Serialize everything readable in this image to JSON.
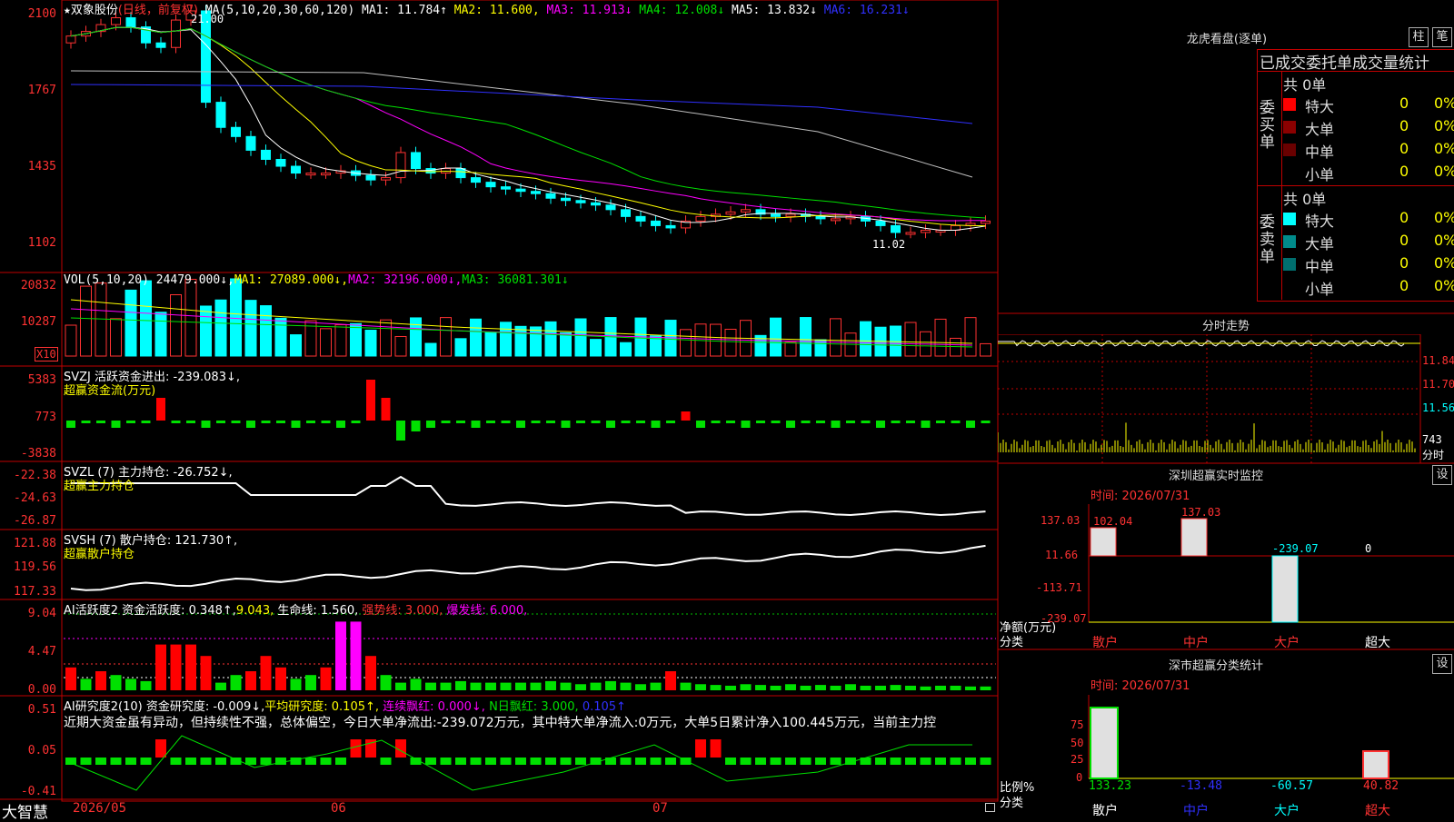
{
  "main_chart": {
    "star": "★",
    "stock_name": "双象股份",
    "mode": "(日线，前复权)",
    "ma_label": "MA(5,10,20,30,60,120)",
    "ma1": "MA1: 11.784↑",
    "ma2": "MA2: 11.600,",
    "ma3": "MA3: 11.913↓",
    "ma4": "MA4: 12.008↓",
    "ma5": "MA5: 13.832↓",
    "ma6": "MA6: 16.231↓",
    "high_label": "21.00",
    "low_label": "11.02",
    "y_ticks": [
      "2100",
      "1767",
      "1435",
      "1102"
    ],
    "colors": {
      "up": "#ff3232",
      "down": "#00ffff",
      "ma1": "#ffffff",
      "ma2": "#ffff00",
      "ma3": "#ff00ff",
      "ma4": "#00e000",
      "ma5": "#c0c0c0",
      "ma6": "#3030ff"
    }
  },
  "vol_panel": {
    "title": "VOL(5,10,20)",
    "value": "24479.000↓,",
    "ma1": "MA1: 27089.000↓,",
    "ma2": "MA2: 32196.000↓,",
    "ma3": "MA3: 36081.301↓",
    "y_ticks": [
      "20832",
      "10287"
    ],
    "unit": "X10"
  },
  "svzj_panel": {
    "title": "SVZJ  活跃资金进出: -239.083↓,",
    "subtitle": "超赢资金流(万元)",
    "y_ticks": [
      "5383",
      "773",
      "-3838"
    ]
  },
  "svzl_panel": {
    "title": "SVZL (7) 主力持仓: -26.752↓,",
    "subtitle": "超赢主力持仓",
    "y_ticks": [
      "-22.38",
      "-24.63",
      "-26.87"
    ]
  },
  "svsh_panel": {
    "title": "SVSH (7) 散户持仓: 121.730↑,",
    "subtitle": "超赢散户持仓",
    "y_ticks": [
      "121.88",
      "119.56",
      "117.33"
    ]
  },
  "ai_active": {
    "title": "AI活跃度2 资金活跃度: 0.348↑,",
    "v2": "9.043,",
    "life": "生命线: 1.560,",
    "strong": "强势线: 3.000,",
    "burst": "爆发线: 6.000,",
    "y_ticks": [
      "9.04",
      "4.47",
      "0.00"
    ]
  },
  "ai_research": {
    "title": "AI研究度2(10) 资金研究度: -0.009↓,",
    "avg": "平均研究度: 0.105↑,",
    "red": "连续飘红: 0.000↓,",
    "nred": "N日飘红: 3.000,",
    "last": "0.105↑",
    "y_ticks": [
      "0.51",
      "0.05",
      "-0.41"
    ],
    "comment": "近期大资金虽有异动，但持续性不强，总体偏空，今日大单净流出:-239.072万元，其中特大单净流入:0万元，大单5日累计净入100.445万元，当前主力控"
  },
  "bottom_bar": {
    "brand": "大智慧",
    "dates": [
      "2026/05",
      "06",
      "07"
    ]
  },
  "lhb_panel": {
    "title": "龙虎看盘(逐单)",
    "btn1": "柱",
    "btn2": "笔",
    "subtitle": "已成交委托单成交量统计",
    "buy_label": "委买单",
    "sell_label": "委卖单",
    "buy_total": "共 0单",
    "sell_total": "共 0单",
    "buy_rows": [
      {
        "name": "特大",
        "n": "0",
        "pct": "0%",
        "color": "#ff0000"
      },
      {
        "name": "大单",
        "n": "0",
        "pct": "0%",
        "color": "#8b0000"
      },
      {
        "name": "中单",
        "n": "0",
        "pct": "0%",
        "color": "#6a0000"
      },
      {
        "name": "小单",
        "n": "0",
        "pct": "0%",
        "color": "#000000"
      }
    ],
    "sell_rows": [
      {
        "name": "特大",
        "n": "0",
        "pct": "0%",
        "color": "#00ffff"
      },
      {
        "name": "大单",
        "n": "0",
        "pct": "0%",
        "color": "#008b8b"
      },
      {
        "name": "中单",
        "n": "0",
        "pct": "0%",
        "color": "#006f6f"
      },
      {
        "name": "小单",
        "n": "0",
        "pct": "0%",
        "color": "#000000"
      }
    ]
  },
  "intraday": {
    "title": "分时走势",
    "y_ticks": [
      "11.84",
      "11.70",
      "11.56"
    ],
    "vol_label": "743",
    "vol_unit": "分时"
  },
  "sz_monitor": {
    "title": "深圳超赢实时监控",
    "btn": "设",
    "time": "时间: 2026/07/31",
    "y_ticks": [
      "137.03",
      "11.66",
      "-113.71",
      "-239.07"
    ],
    "labels": [
      "102.04",
      "137.03",
      "-239.07",
      "0"
    ],
    "ylabel": "净额(万元)",
    "xlabel": "分类",
    "cats": [
      "散户",
      "中户",
      "大户",
      "超大"
    ]
  },
  "sz_class": {
    "title": "深市超赢分类统计",
    "btn": "设",
    "time": "时间: 2026/07/31",
    "y_ticks": [
      "75",
      "50",
      "25",
      "0"
    ],
    "values": [
      "133.23",
      "-13.48",
      "-60.57",
      "40.82"
    ],
    "ylabel": "比例%",
    "xlabel": "分类",
    "cats": [
      "散户",
      "中户",
      "大户",
      "超大"
    ]
  }
}
